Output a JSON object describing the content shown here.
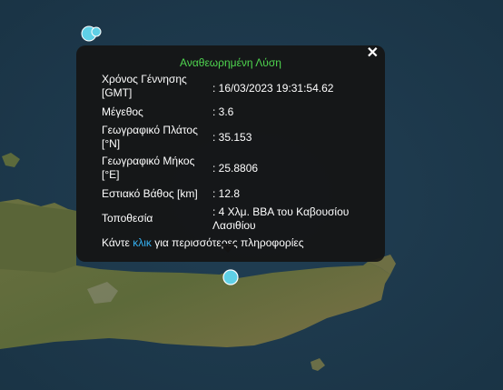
{
  "popup": {
    "title": "Αναθεωρημένη Λύση",
    "close_label": "✕",
    "rows": [
      {
        "label": "Χρόνος Γέννησης [GMT]",
        "value": ": 16/03/2023 19:31:54.62"
      },
      {
        "label": "Μέγεθος",
        "value": ": 3.6"
      },
      {
        "label": "Γεωγραφικό Πλάτος [°N]",
        "value": ": 35.153"
      },
      {
        "label": "Γεωγραφικό Μήκος [°E]",
        "value": ": 25.8806"
      },
      {
        "label": "Εστιακό Βάθος [km]",
        "value": ": 12.8"
      },
      {
        "label": "Τοποθεσία",
        "value": ": 4 Χλμ. ΒΒΑ του Καβουσίου Λασιθίου"
      }
    ],
    "footer_prefix": "Κάντε ",
    "footer_link": "κλικ",
    "footer_suffix": " για περισσότερες πληροφορίες"
  },
  "colors": {
    "title": "#4fd64f",
    "link": "#35b0f0",
    "marker": "#5fd0e6"
  }
}
